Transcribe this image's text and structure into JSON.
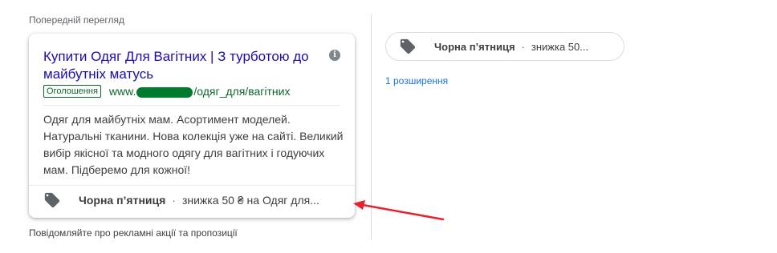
{
  "preview": {
    "label": "Попередній перегляд",
    "footer": "Повідомляйте про рекламні акції та пропозиції"
  },
  "ad": {
    "headline": "Купити Одяг Для Вагітних | З турботою до майбутніх матусь",
    "info_icon": "i",
    "badge": "Оголошення",
    "url_prefix": "www.",
    "url_suffix": "/одяг_для/вагітних",
    "description": "Одяг для майбутніх мам. Асортимент моделей. Натуральні тканини. Нова колекція уже на сайті. Великий вибір якісної та модного одягу для вагітних і годуючих мам. Підберемо для кожної!",
    "promotion": {
      "icon": "tag-icon",
      "title": "Чорна п’ятниця",
      "separator": "·",
      "detail": "знижка 50 ₴ на Одяг для..."
    }
  },
  "extension_panel": {
    "chip": {
      "icon": "tag-icon",
      "title": "Чорна п’ятниця",
      "separator": "·",
      "detail": "знижка 50..."
    },
    "link": "1 розширення"
  },
  "colors": {
    "headline": "#1a0dab",
    "url": "#0d652d",
    "link": "#1a73e8",
    "arrow": "#e8212e",
    "redaction": "#007b2e"
  }
}
